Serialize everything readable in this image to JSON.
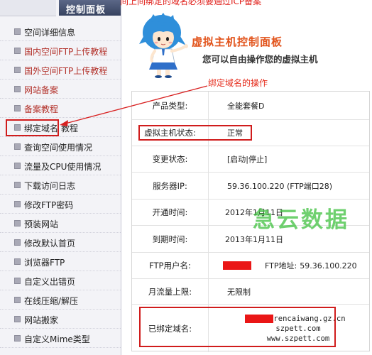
{
  "notice": "间上间绑定的域名必须要通过ICP备案",
  "sidebar": {
    "header": "控制面板",
    "bullet_icon": "square-bullet-icon",
    "items": [
      {
        "label": "空间详细信息"
      },
      {
        "label": "国内空间FTP上传教程"
      },
      {
        "label": "国外空间FTP上传教程"
      },
      {
        "label": "网站备案"
      },
      {
        "label": "备案教程"
      },
      {
        "label": "绑定域名",
        "suffix": "教程"
      },
      {
        "label": "查询空间使用情况"
      },
      {
        "label": "流量及CPU使用情况"
      },
      {
        "label": "下载访问日志"
      },
      {
        "label": "修改FTP密码"
      },
      {
        "label": "预装网站"
      },
      {
        "label": "修改默认首页"
      },
      {
        "label": "浏览器FTP"
      },
      {
        "label": "自定义出错页"
      },
      {
        "label": "在线压缩/解压"
      },
      {
        "label": "网站搬家"
      },
      {
        "label": "自定义Mime类型"
      }
    ]
  },
  "banner": {
    "title": "虚拟主机控制面板",
    "subtitle": "您可以自由操作您的虚拟主机"
  },
  "annotation": {
    "text": "绑定域名的操作"
  },
  "info": {
    "product_type": {
      "label": "产品类型:",
      "value": "全能套餐D"
    },
    "status": {
      "label": "虚拟主机状态:",
      "value": "正常"
    },
    "change_status": {
      "label": "变更状态:",
      "open": "[",
      "start": "启动",
      "sep": "|",
      "stop": "停止",
      "close": "]"
    },
    "server_ip": {
      "label": "服务器IP:",
      "value": "59.36.100.220 (FTP端口28)"
    },
    "open_date": {
      "label": "开通时间:",
      "value": "2012年1月11日"
    },
    "expire_date": {
      "label": "到期时间:",
      "value": "2013年1月11日"
    },
    "ftp": {
      "label": "FTP用户名:",
      "addr_label": "FTP地址:",
      "addr": "59.36.100.220"
    },
    "traffic": {
      "label": "月流量上限:",
      "value": "无限制"
    },
    "domains": {
      "label": "已绑定域名:",
      "items": [
        "rencaiwang.gz.cn",
        "szpett.com",
        "www.szpett.com"
      ]
    }
  },
  "watermark": "急云数据",
  "colors": {
    "annotation_red": "#d01c1c",
    "notice_red": "#e0201b",
    "menu_red": "#b3322b",
    "title_orange": "#e2541c",
    "header_bg": "#36425f",
    "watermark_green": "#46c346"
  }
}
